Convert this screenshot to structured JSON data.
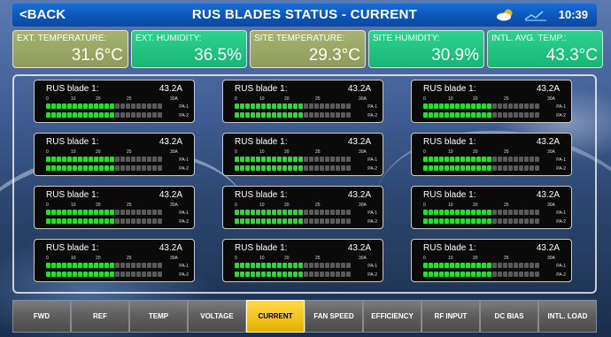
{
  "header": {
    "back_label": "<BACK",
    "title": "RUS BLADES STATUS - CURRENT",
    "time": "10:39"
  },
  "metrics": [
    {
      "label": "EXT. TEMPERATURE:",
      "value": "31.6°C",
      "color": "#98a565"
    },
    {
      "label": "EXT. HUMIDITY:",
      "value": "36.5%",
      "color": "#22c580"
    },
    {
      "label": "SITE TEMPERATURE:",
      "value": "29.3°C",
      "color": "#98a565"
    },
    {
      "label": "SITE HUMIDITY:",
      "value": "30.9%",
      "color": "#22c580"
    },
    {
      "label": "INTL. AVG. TEMP.:",
      "value": "43.3°C",
      "color": "#22c580"
    }
  ],
  "blade_common": {
    "scale_ticks": [
      "0",
      "10",
      "20",
      "25",
      "30A"
    ],
    "pa1_label": "PA-1",
    "pa2_label": "PA-2",
    "total_segments": 22,
    "on_color": "#22e02a",
    "off_color": "#5a5a5a"
  },
  "blades": [
    {
      "name": "RUS blade 1:",
      "current": "43.2A",
      "pa1_segments_on": 13,
      "pa2_segments_on": 13
    },
    {
      "name": "RUS blade 1:",
      "current": "43.2A",
      "pa1_segments_on": 13,
      "pa2_segments_on": 13
    },
    {
      "name": "RUS blade 1:",
      "current": "43.2A",
      "pa1_segments_on": 13,
      "pa2_segments_on": 13
    },
    {
      "name": "RUS blade 1:",
      "current": "43.2A",
      "pa1_segments_on": 13,
      "pa2_segments_on": 13
    },
    {
      "name": "RUS blade 1:",
      "current": "43.2A",
      "pa1_segments_on": 13,
      "pa2_segments_on": 13
    },
    {
      "name": "RUS blade 1:",
      "current": "43.2A",
      "pa1_segments_on": 13,
      "pa2_segments_on": 13
    },
    {
      "name": "RUS blade 1:",
      "current": "43.2A",
      "pa1_segments_on": 13,
      "pa2_segments_on": 13
    },
    {
      "name": "RUS blade 1:",
      "current": "43.2A",
      "pa1_segments_on": 13,
      "pa2_segments_on": 13
    },
    {
      "name": "RUS blade 1:",
      "current": "43.2A",
      "pa1_segments_on": 13,
      "pa2_segments_on": 13
    },
    {
      "name": "RUS blade 1:",
      "current": "43.2A",
      "pa1_segments_on": 13,
      "pa2_segments_on": 13
    },
    {
      "name": "RUS blade 1:",
      "current": "43.2A",
      "pa1_segments_on": 13,
      "pa2_segments_on": 13
    },
    {
      "name": "RUS blade 1:",
      "current": "43.2A",
      "pa1_segments_on": 13,
      "pa2_segments_on": 13
    }
  ],
  "tabs": [
    {
      "label": "FWD",
      "active": false
    },
    {
      "label": "REF",
      "active": false
    },
    {
      "label": "TEMP",
      "active": false
    },
    {
      "label": "VOLTAGE",
      "active": false
    },
    {
      "label": "CURRENT",
      "active": true
    },
    {
      "label": "FAN SPEED",
      "active": false
    },
    {
      "label": "EFFICIENCY",
      "active": false
    },
    {
      "label": "RF INPUT",
      "active": false
    },
    {
      "label": "DC BIAS",
      "active": false
    },
    {
      "label": "INTL. LOAD",
      "active": false
    }
  ],
  "colors": {
    "header_blue": "#0c56b8",
    "active_tab": "#f2c21a",
    "tab_gray": "#5d5d5d"
  },
  "icons": [
    "weather-cloud-sun-icon",
    "trend-line-icon"
  ]
}
